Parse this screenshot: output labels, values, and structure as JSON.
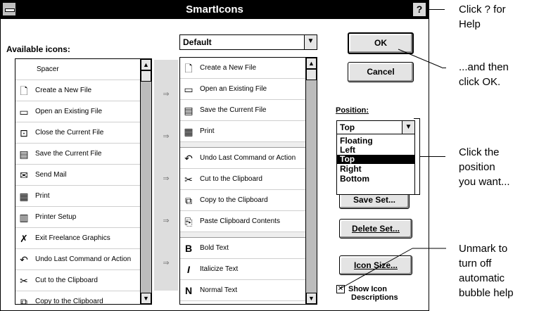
{
  "window": {
    "title": "SmartIcons",
    "help_button": "?"
  },
  "available": {
    "label": "Available icons:",
    "items": [
      {
        "text": "Spacer",
        "icon": ""
      },
      {
        "text": "Create a New File",
        "icon": "new-file-icon"
      },
      {
        "text": "Open an Existing File",
        "icon": "open-folder-icon"
      },
      {
        "text": "Close the Current File",
        "icon": "close-file-icon"
      },
      {
        "text": "Save the Current File",
        "icon": "save-icon"
      },
      {
        "text": "Send Mail",
        "icon": "mail-icon"
      },
      {
        "text": "Print",
        "icon": "printer-icon"
      },
      {
        "text": "Printer Setup",
        "icon": "printer-setup-icon"
      },
      {
        "text": "Exit Freelance Graphics",
        "icon": "exit-icon"
      },
      {
        "text": "Undo Last Command or Action",
        "icon": "undo-icon"
      },
      {
        "text": "Cut to the Clipboard",
        "icon": "scissors-icon"
      },
      {
        "text": "Copy to the Clipboard",
        "icon": "copy-icon"
      }
    ]
  },
  "set_combo": {
    "value": "Default"
  },
  "current_set": {
    "items": [
      {
        "text": "Create a New File",
        "icon": "new-file-icon"
      },
      {
        "text": "Open an Existing File",
        "icon": "open-folder-icon"
      },
      {
        "text": "Save the Current File",
        "icon": "save-icon"
      },
      {
        "text": "Print",
        "icon": "printer-icon"
      },
      {
        "text": "Undo Last Command or Action",
        "icon": "undo-icon"
      },
      {
        "text": "Cut to the Clipboard",
        "icon": "scissors-icon"
      },
      {
        "text": "Copy to the Clipboard",
        "icon": "copy-icon"
      },
      {
        "text": "Paste Clipboard Contents",
        "icon": "paste-icon"
      },
      {
        "text": "Bold Text",
        "icon": "bold-icon"
      },
      {
        "text": "Italicize Text",
        "icon": "italic-icon"
      },
      {
        "text": "Normal Text",
        "icon": "normal-text-icon"
      }
    ]
  },
  "buttons": {
    "ok": "OK",
    "cancel": "Cancel",
    "save_set": "Save Set...",
    "delete_set": "Delete Set...",
    "icon_size": "Icon Size..."
  },
  "position": {
    "label": "Position:",
    "value": "Top",
    "options": [
      "Floating",
      "Left",
      "Top",
      "Right",
      "Bottom"
    ],
    "selected": "Top"
  },
  "show_descriptions": {
    "label_line1": "Show Icon",
    "label_line2": "Descriptions",
    "checked": true
  },
  "annotations": {
    "help_line1": "Click ? for",
    "help_line2": "Help",
    "ok_line1": "...and then",
    "ok_line2": "click OK.",
    "pos_line1": "Click the",
    "pos_line2": "position",
    "pos_line3": "you want...",
    "unmark_line1": "Unmark to",
    "unmark_line2": "turn off",
    "unmark_line3": "automatic",
    "unmark_line4": "bubble help"
  }
}
